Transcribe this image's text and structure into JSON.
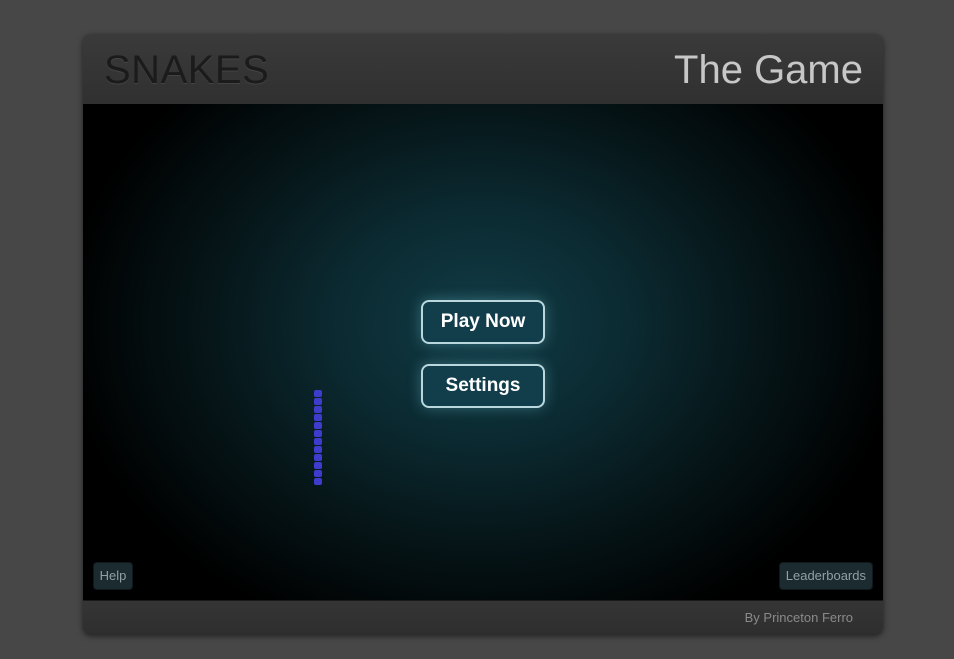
{
  "header": {
    "title": "SNAKES",
    "subtitle": "The Game"
  },
  "menu": {
    "play_label": "Play Now",
    "settings_label": "Settings"
  },
  "corner_buttons": {
    "help_label": "Help",
    "leaderboards_label": "Leaderboards"
  },
  "footer": {
    "credit": "By Princeton Ferro"
  },
  "snake": {
    "segments": 12,
    "color": "#3d3ccc"
  },
  "colors": {
    "button_border": "#b9d7dc",
    "button_fill": "#123e4c",
    "board_glow": "#123c46"
  }
}
